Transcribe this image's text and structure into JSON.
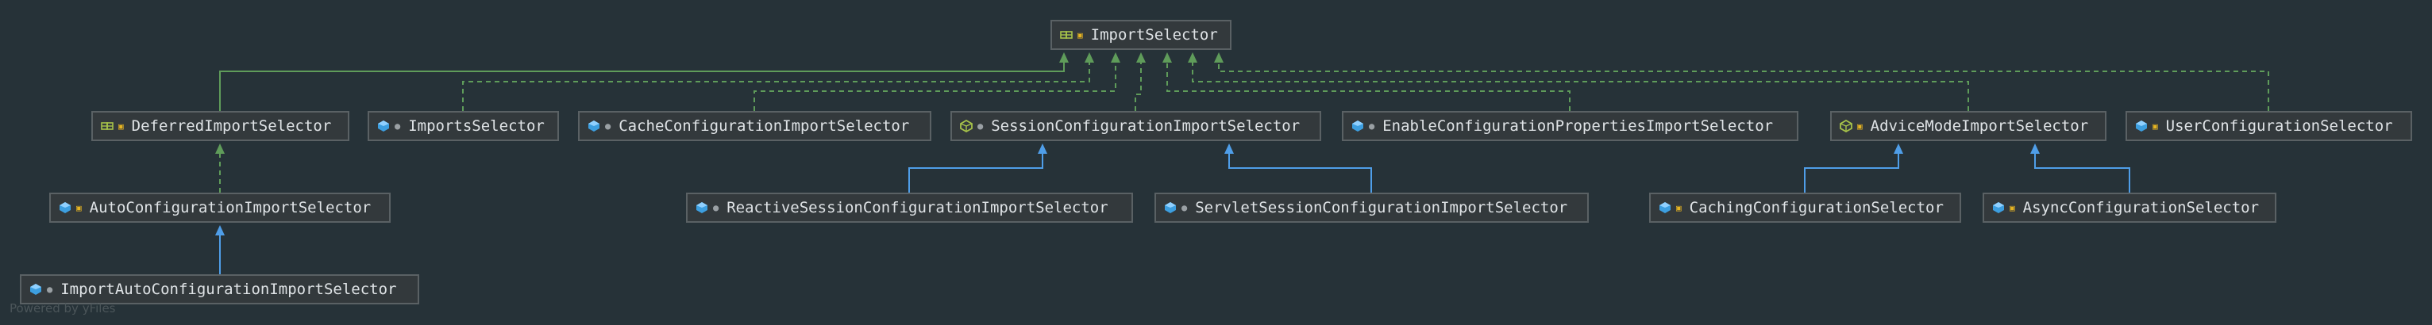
{
  "footer_text": "Powered by yFiles",
  "nodes": [
    {
      "id": "import-selector",
      "label": "ImportSelector",
      "icon": "interface-icon",
      "modifier": "lock"
    },
    {
      "id": "deferred-import-selector",
      "label": "DeferredImportSelector",
      "icon": "interface-icon",
      "modifier": "lock"
    },
    {
      "id": "imports-selector",
      "label": "ImportsSelector",
      "icon": "class-icon",
      "modifier": "dot"
    },
    {
      "id": "cache-configuration-import-selector",
      "label": "CacheConfigurationImportSelector",
      "icon": "class-icon",
      "modifier": "dot"
    },
    {
      "id": "session-configuration-import-selector",
      "label": "SessionConfigurationImportSelector",
      "icon": "abstract-class-icon",
      "modifier": "dot"
    },
    {
      "id": "enable-configuration-properties-import-selector",
      "label": "EnableConfigurationPropertiesImportSelector",
      "icon": "class-icon",
      "modifier": "dot"
    },
    {
      "id": "advice-mode-import-selector",
      "label": "AdviceModeImportSelector",
      "icon": "abstract-class-icon",
      "modifier": "lock"
    },
    {
      "id": "user-configuration-selector",
      "label": "UserConfigurationSelector",
      "icon": "class-icon",
      "modifier": "lock"
    },
    {
      "id": "auto-configuration-import-selector",
      "label": "AutoConfigurationImportSelector",
      "icon": "class-icon",
      "modifier": "lock"
    },
    {
      "id": "reactive-session-configuration-import-selector",
      "label": "ReactiveSessionConfigurationImportSelector",
      "icon": "class-icon",
      "modifier": "dot"
    },
    {
      "id": "servlet-session-configuration-import-selector",
      "label": "ServletSessionConfigurationImportSelector",
      "icon": "class-icon",
      "modifier": "dot"
    },
    {
      "id": "caching-configuration-selector",
      "label": "CachingConfigurationSelector",
      "icon": "class-icon",
      "modifier": "lock"
    },
    {
      "id": "async-configuration-selector",
      "label": "AsyncConfigurationSelector",
      "icon": "class-icon",
      "modifier": "lock"
    },
    {
      "id": "import-auto-configuration-import-selector",
      "label": "ImportAutoConfigurationImportSelector",
      "icon": "class-icon",
      "modifier": "dot"
    }
  ],
  "edges": [
    {
      "from": "deferred-import-selector",
      "to": "import-selector",
      "kind": "extends"
    },
    {
      "from": "imports-selector",
      "to": "import-selector",
      "kind": "implements"
    },
    {
      "from": "cache-configuration-import-selector",
      "to": "import-selector",
      "kind": "implements"
    },
    {
      "from": "session-configuration-import-selector",
      "to": "import-selector",
      "kind": "implements"
    },
    {
      "from": "enable-configuration-properties-import-selector",
      "to": "import-selector",
      "kind": "implements"
    },
    {
      "from": "advice-mode-import-selector",
      "to": "import-selector",
      "kind": "implements"
    },
    {
      "from": "user-configuration-selector",
      "to": "import-selector",
      "kind": "implements"
    },
    {
      "from": "auto-configuration-import-selector",
      "to": "deferred-import-selector",
      "kind": "implements"
    },
    {
      "from": "import-auto-configuration-import-selector",
      "to": "auto-configuration-import-selector",
      "kind": "extends"
    },
    {
      "from": "reactive-session-configuration-import-selector",
      "to": "session-configuration-import-selector",
      "kind": "extends"
    },
    {
      "from": "servlet-session-configuration-import-selector",
      "to": "session-configuration-import-selector",
      "kind": "extends"
    },
    {
      "from": "caching-configuration-selector",
      "to": "advice-mode-import-selector",
      "kind": "extends"
    },
    {
      "from": "async-configuration-selector",
      "to": "advice-mode-import-selector",
      "kind": "extends"
    }
  ],
  "colors": {
    "background": "#263238",
    "node_fill": "#33393c",
    "node_border": "#5a6164",
    "text": "#dfe3e6",
    "implements_edge": "#5f9c5a",
    "extends_class_edge": "#4f9ee8",
    "extends_interface_edge": "#5f9c5a",
    "class_icon": "#3d9fe0",
    "interface_icon": "#a7c34a",
    "lock": "#e6b422"
  }
}
